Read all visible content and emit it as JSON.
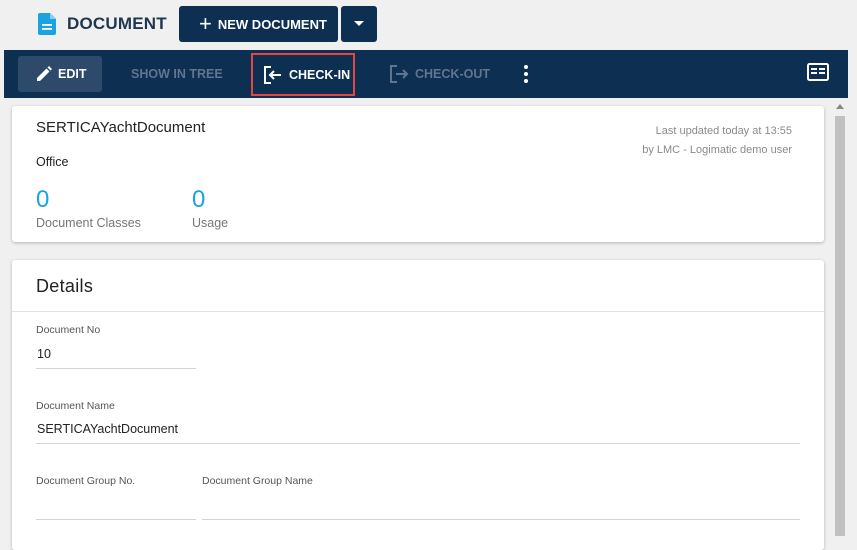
{
  "app": {
    "title": "DOCUMENT",
    "new_document_label": "NEW DOCUMENT"
  },
  "toolbar": {
    "edit": "EDIT",
    "show_in_tree": "SHOW IN TREE",
    "check_in": "CHECK-IN",
    "check_out": "CHECK-OUT"
  },
  "summary": {
    "name": "SERTICAYachtDocument",
    "type": "Office",
    "last_updated": "Last updated today at 13:55",
    "updated_by": "by LMC - Logimatic demo user",
    "document_classes_value": "0",
    "document_classes_label": "Document Classes",
    "usage_value": "0",
    "usage_label": "Usage"
  },
  "details": {
    "title": "Details",
    "document_no_label": "Document No",
    "document_no_value": "10",
    "document_name_label": "Document Name",
    "document_name_value": "SERTICAYachtDocument",
    "group_no_label": "Document Group No.",
    "group_no_value": "",
    "group_name_label": "Document Group Name",
    "group_name_value": ""
  },
  "colors": {
    "header_bg": "#0d2f52",
    "accent": "#1aa3e0",
    "highlight": "#e44545"
  },
  "icons": [
    "document-icon",
    "plus-icon",
    "caret-down-icon",
    "pencil-icon",
    "check-in-icon",
    "check-out-icon",
    "more-vert-icon",
    "panel-icon"
  ]
}
